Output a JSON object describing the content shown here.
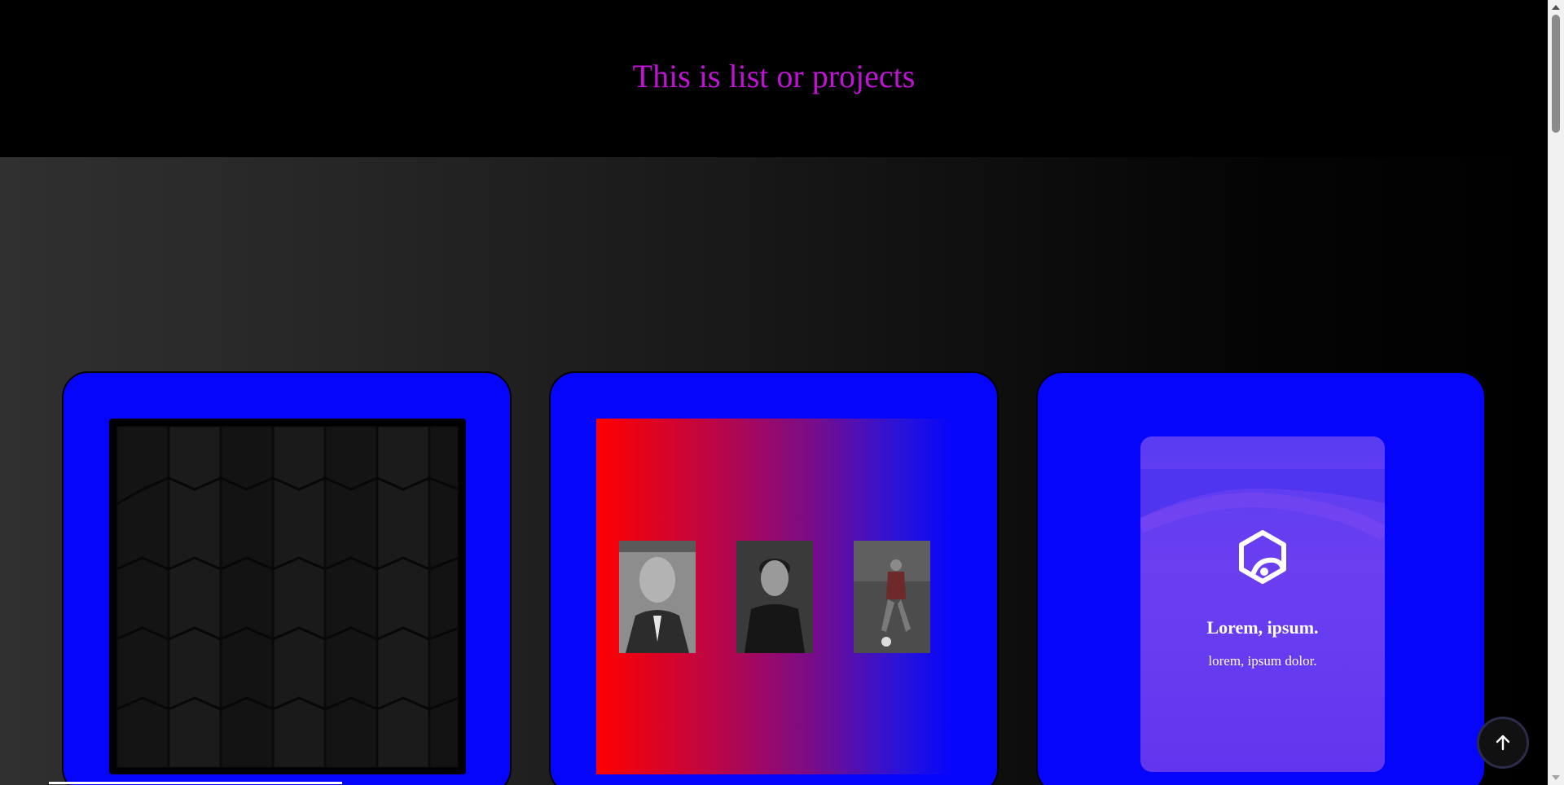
{
  "header": {
    "title": "This is list or projects"
  },
  "cards": [
    {
      "name": "hexagon-pattern-card"
    },
    {
      "name": "photo-gallery-card",
      "photos": [
        {
          "name": "photo-man-suit"
        },
        {
          "name": "photo-young-man"
        },
        {
          "name": "photo-soccer-player"
        }
      ]
    },
    {
      "name": "feature-card",
      "title": "Lorem, ipsum.",
      "subtitle": "lorem, ipsum dolor.",
      "icon": "hexagon-logo-icon"
    }
  ],
  "scroll_top": {
    "icon": "arrow-up-icon"
  },
  "colors": {
    "header_title": "#c013d6",
    "card_bg": "#0505fb",
    "gallery_gradient_start": "#ff0000",
    "gallery_gradient_end": "#0505fb",
    "mini_card": "#6236ee"
  }
}
